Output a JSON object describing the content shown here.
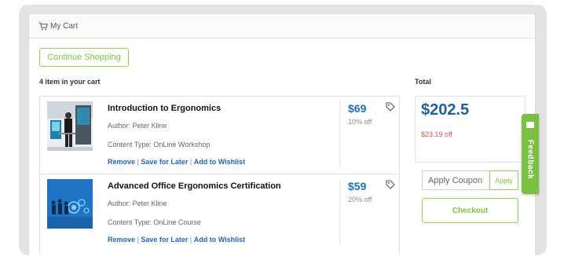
{
  "header": {
    "title": "My Cart",
    "icon": "cart-icon"
  },
  "continue_shopping_label": "Continue Shopping",
  "items_count_text": "4 item in your cart",
  "total_label": "Total",
  "items": [
    {
      "title": "Introduction to Ergonomics",
      "author": "Author: Peter Kline",
      "content_type": "Content Type: OnLine Workshop",
      "price": "$69",
      "discount": "10% off",
      "actions": {
        "remove": "Remove",
        "save": "Save for Later",
        "wishlist": "Add to Wishlist"
      }
    },
    {
      "title": "Advanced Office Ergonomics Certification",
      "author": "Author: Peter Kline",
      "content_type": "Content Type: OnLine Course",
      "price": "$59",
      "discount": "20% off",
      "actions": {
        "remove": "Remove",
        "save": "Save for Later",
        "wishlist": "Add to Wishlist"
      }
    }
  ],
  "summary": {
    "total": "$202.5",
    "total_off": "$23.19 off"
  },
  "coupon": {
    "placeholder": "Apply Coupon",
    "apply_label": "Apply"
  },
  "checkout_label": "Checkout",
  "feedback_label": "Feedback",
  "colors": {
    "accent_green": "#7cc243",
    "price_blue": "#1f6fb6",
    "discount_red": "#d9534f",
    "link_blue": "#2266b8"
  }
}
